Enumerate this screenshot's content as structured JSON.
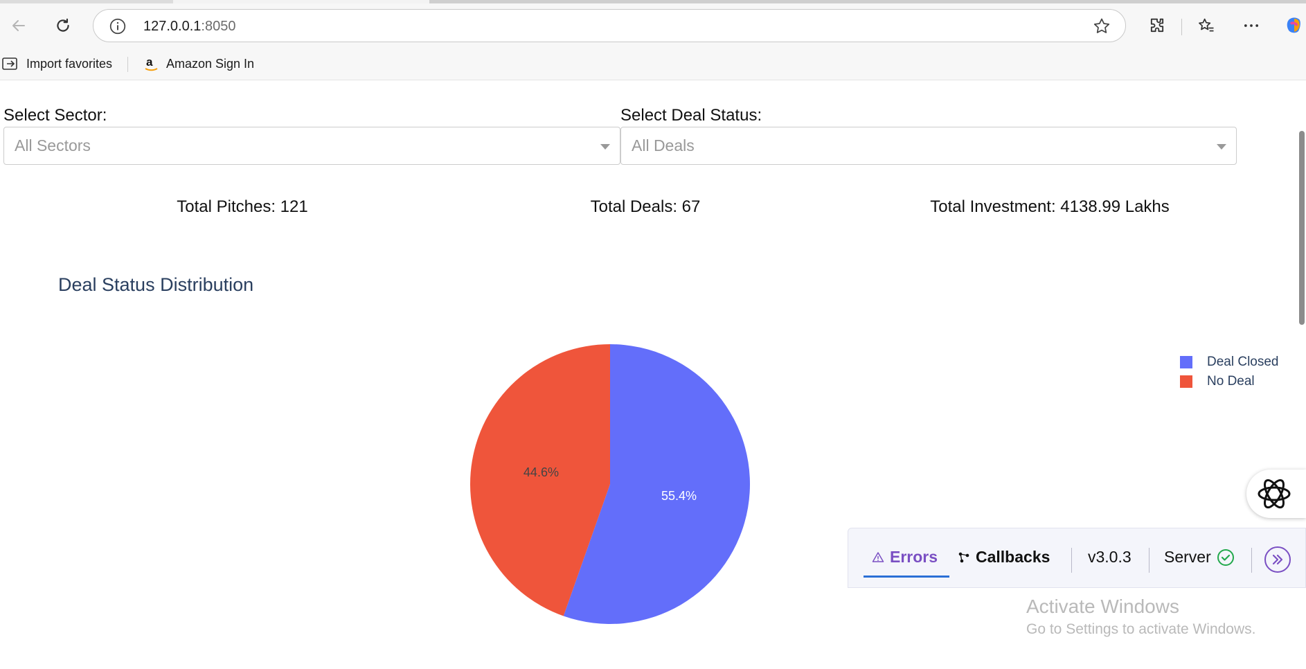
{
  "browser": {
    "url_host": "127.0.0.1",
    "url_port": ":8050",
    "favorites": [
      {
        "label": "Import favorites",
        "icon": "import-favorites-icon"
      },
      {
        "label": "Amazon Sign In",
        "icon": "amazon-icon"
      }
    ]
  },
  "filters": {
    "sector_label": "Select Sector:",
    "sector_placeholder": "All Sectors",
    "status_label": "Select Deal Status:",
    "status_placeholder": "All Deals"
  },
  "stats": {
    "total_pitches": "Total Pitches: 121",
    "total_deals": "Total Deals: 67",
    "total_investment": "Total Investment: 4138.99 Lakhs"
  },
  "chart_data": {
    "type": "pie",
    "title": "Deal Status Distribution",
    "labels": [
      "Deal Closed",
      "No Deal"
    ],
    "values": [
      55.4,
      44.6
    ],
    "text_labels": [
      "55.4%",
      "44.6%"
    ],
    "colors": [
      "#636efa",
      "#ef553b"
    ],
    "legend_position": "top-right"
  },
  "debug_menu": {
    "errors": "Errors",
    "callbacks": "Callbacks",
    "version": "v3.0.3",
    "server": "Server",
    "accent": "#7a4fc3"
  },
  "watermark": {
    "line1": "Activate Windows",
    "line2": "Go to Settings to activate Windows."
  }
}
